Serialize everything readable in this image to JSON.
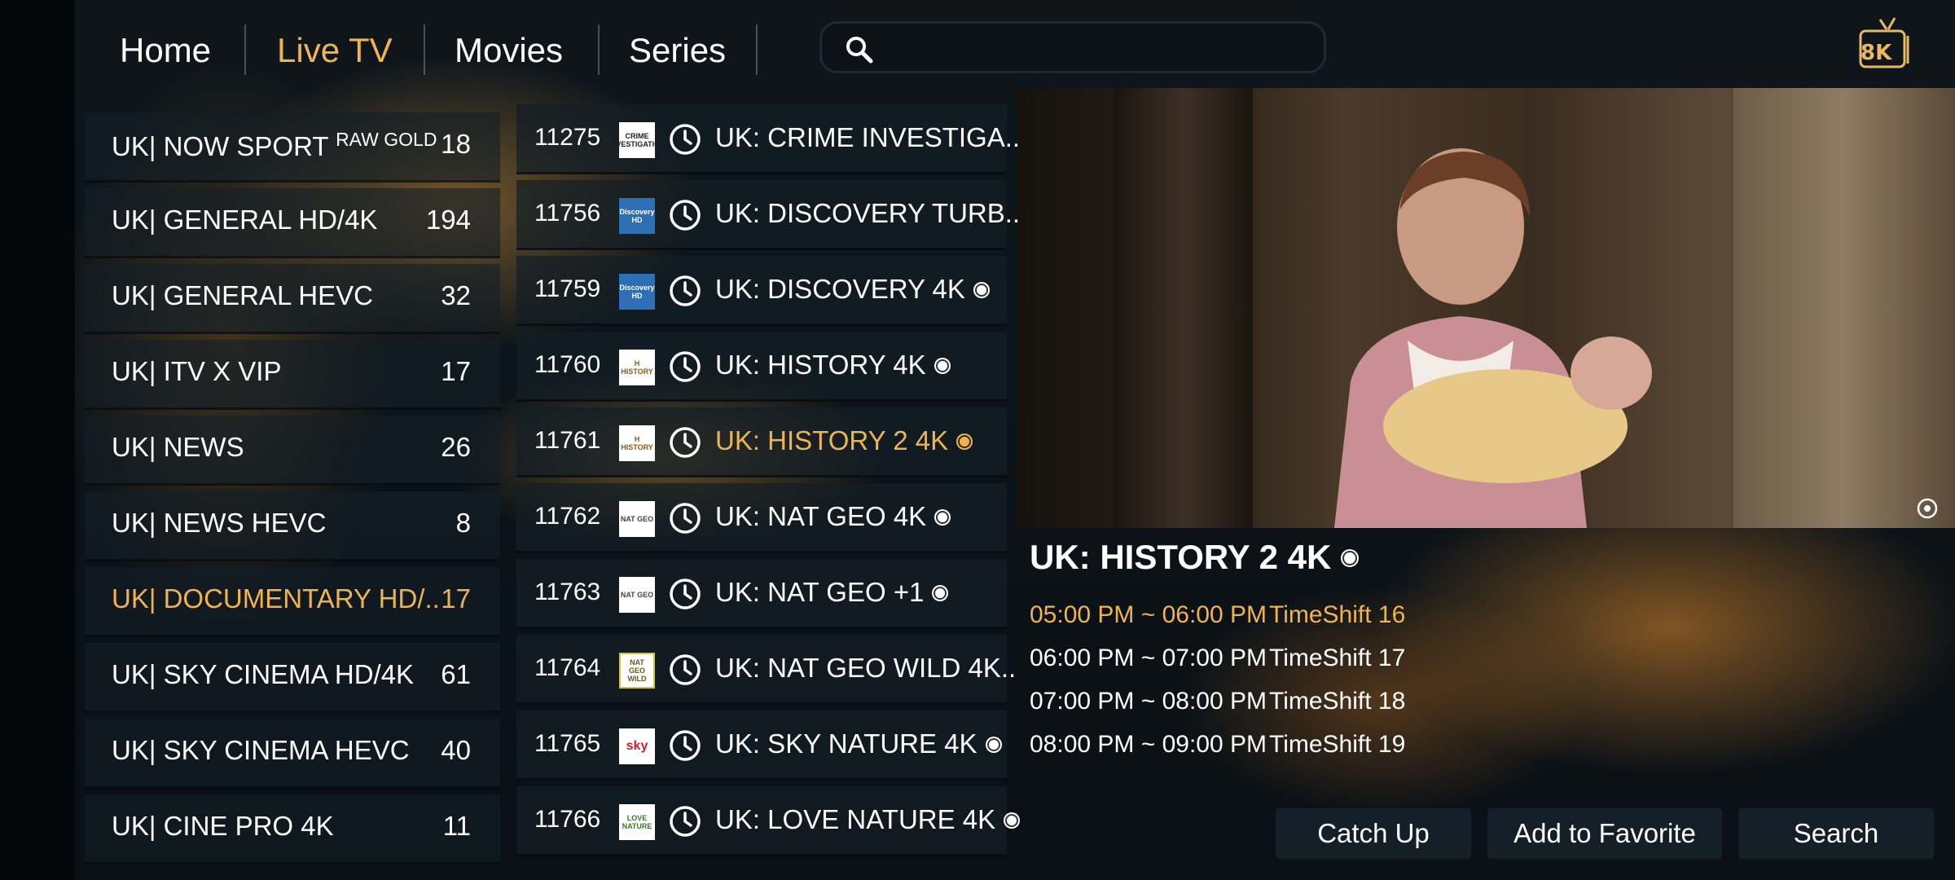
{
  "nav": {
    "tabs": [
      {
        "label": "Home"
      },
      {
        "label": "Live TV"
      },
      {
        "label": "Movies"
      },
      {
        "label": "Series"
      }
    ],
    "active_tab": "Live TV",
    "search_placeholder": "",
    "badge_label": "8K"
  },
  "categories": [
    {
      "label": "UK| NOW SPORT",
      "label_sup": "RAW GOLD",
      "count": "18"
    },
    {
      "label": "UK| GENERAL HD/4K",
      "count": "194"
    },
    {
      "label": "UK| GENERAL HEVC",
      "count": "32"
    },
    {
      "label": "UK| ITV X VIP",
      "count": "17"
    },
    {
      "label": "UK| NEWS",
      "count": "26"
    },
    {
      "label": "UK| NEWS HEVC",
      "count": "8"
    },
    {
      "label": "UK| DOCUMENTARY HD/..",
      "count": "17"
    },
    {
      "label": "UK| SKY CINEMA HD/4K",
      "count": "61"
    },
    {
      "label": "UK| SKY CINEMA HEVC",
      "count": "40"
    },
    {
      "label": "UK| CINE PRO 4K",
      "count": "11"
    }
  ],
  "active_category": "UK| DOCUMENTARY HD/..",
  "channels": [
    {
      "number": "11275",
      "logo": "CRIME INVESTIGATION",
      "name": "UK: CRIME INVESTIGA..",
      "live": false
    },
    {
      "number": "11756",
      "logo": "Discovery HD",
      "name": "UK: DISCOVERY TURB..",
      "live": false
    },
    {
      "number": "11759",
      "logo": "Discovery HD",
      "name": "UK: DISCOVERY 4K",
      "live": true
    },
    {
      "number": "11760",
      "logo": "H HISTORY",
      "name": "UK: HISTORY 4K",
      "live": true
    },
    {
      "number": "11761",
      "logo": "H HISTORY",
      "name": "UK: HISTORY 2 4K",
      "live": true
    },
    {
      "number": "11762",
      "logo": "NAT GEO",
      "name": "UK: NAT GEO 4K",
      "live": true
    },
    {
      "number": "11763",
      "logo": "NAT GEO",
      "name": "UK: NAT GEO +1",
      "live": true
    },
    {
      "number": "11764",
      "logo": "NAT GEO WILD",
      "name": "UK: NAT GEO WILD 4K..",
      "live": false
    },
    {
      "number": "11765",
      "logo": "sky",
      "name": "UK: SKY NATURE 4K",
      "live": true
    },
    {
      "number": "11766",
      "logo": "LOVE NATURE",
      "name": "UK: LOVE NATURE 4K",
      "live": true
    }
  ],
  "active_channel": "11761",
  "program": {
    "title": "UK: HISTORY 2 4K",
    "epg": [
      {
        "time": "05:00 PM ~ 06:00 PM",
        "title": "TimeShift 16",
        "active": true
      },
      {
        "time": "06:00 PM ~ 07:00 PM",
        "title": "TimeShift 17",
        "active": false
      },
      {
        "time": "07:00 PM ~ 08:00 PM",
        "title": "TimeShift 18",
        "active": false
      },
      {
        "time": "08:00 PM ~ 09:00 PM",
        "title": "TimeShift 19",
        "active": false
      }
    ]
  },
  "actions": {
    "catch_up": "Catch Up",
    "add_favorite": "Add to Favorite",
    "search": "Search"
  },
  "colors": {
    "accent": "#f0b44e",
    "text": "#ffffff",
    "panel": "#141e26"
  },
  "icons": {
    "search": "search-icon",
    "clock": "clock-icon",
    "badge": "8k-badge-icon",
    "live_dot": "live-dot-icon"
  }
}
